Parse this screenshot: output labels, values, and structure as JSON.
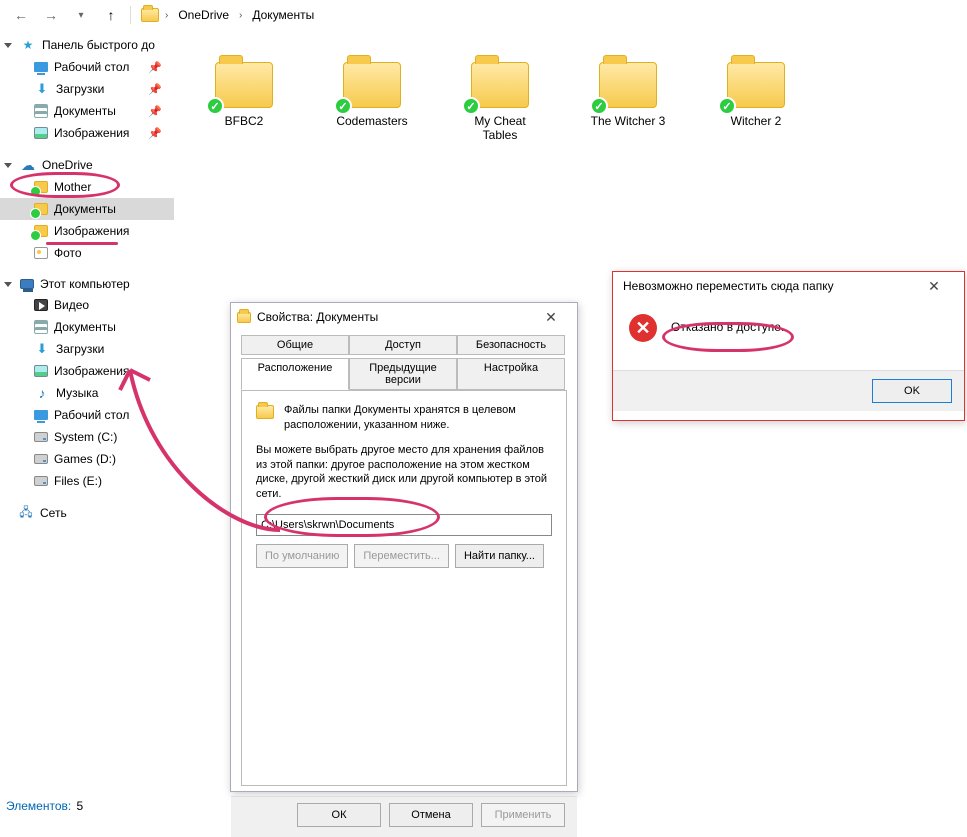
{
  "breadcrumb": {
    "root": "OneDrive",
    "current": "Документы"
  },
  "sidebar": {
    "quick": {
      "header": "Панель быстрого до",
      "items": [
        {
          "label": "Рабочий стол",
          "icon": "desktop",
          "pinned": true
        },
        {
          "label": "Загрузки",
          "icon": "download",
          "pinned": true
        },
        {
          "label": "Документы",
          "icon": "doc",
          "pinned": true
        },
        {
          "label": "Изображения",
          "icon": "img",
          "pinned": true
        }
      ]
    },
    "onedrive": {
      "header": "OneDrive",
      "items": [
        {
          "label": "Mother",
          "icon": "syncfolder"
        },
        {
          "label": "Документы",
          "icon": "syncfolder",
          "selected": true
        },
        {
          "label": "Изображения",
          "icon": "syncfolder"
        },
        {
          "label": "Фото",
          "icon": "photo"
        }
      ]
    },
    "pc": {
      "header": "Этот компьютер",
      "items": [
        {
          "label": "Видео",
          "icon": "vid"
        },
        {
          "label": "Документы",
          "icon": "doc"
        },
        {
          "label": "Загрузки",
          "icon": "download"
        },
        {
          "label": "Изображения",
          "icon": "img"
        },
        {
          "label": "Музыка",
          "icon": "music"
        },
        {
          "label": "Рабочий стол",
          "icon": "desktop"
        },
        {
          "label": "System (C:)",
          "icon": "drive"
        },
        {
          "label": "Games (D:)",
          "icon": "drive"
        },
        {
          "label": "Files (E:)",
          "icon": "drive"
        }
      ]
    },
    "net": {
      "header": "Сеть"
    }
  },
  "folders": [
    "BFBC2",
    "Codemasters",
    "My Cheat Tables",
    "The Witcher 3",
    "Witcher 2"
  ],
  "status": {
    "label": "Элементов:",
    "count": "5"
  },
  "props": {
    "title": "Свойства: Документы",
    "tabs": {
      "general": "Общие",
      "access": "Доступ",
      "security": "Безопасность",
      "location": "Расположение",
      "prev": "Предыдущие версии",
      "settings": "Настройка"
    },
    "desc1": "Файлы папки Документы хранятся в целевом расположении, указанном ниже.",
    "desc2": "Вы можете выбрать другое место для хранения файлов из этой папки: другое расположение на этом жестком диске, другой жесткий диск или другой компьютер в этой сети.",
    "path": "C:\\Users\\skrwn\\Documents",
    "btn_default": "По умолчанию",
    "btn_move": "Переместить...",
    "btn_find": "Найти папку...",
    "ok": "ОК",
    "cancel": "Отмена",
    "apply": "Применить"
  },
  "err": {
    "title": "Невозможно переместить сюда папку",
    "msg": "Отказано в доступе.",
    "ok": "OK"
  }
}
